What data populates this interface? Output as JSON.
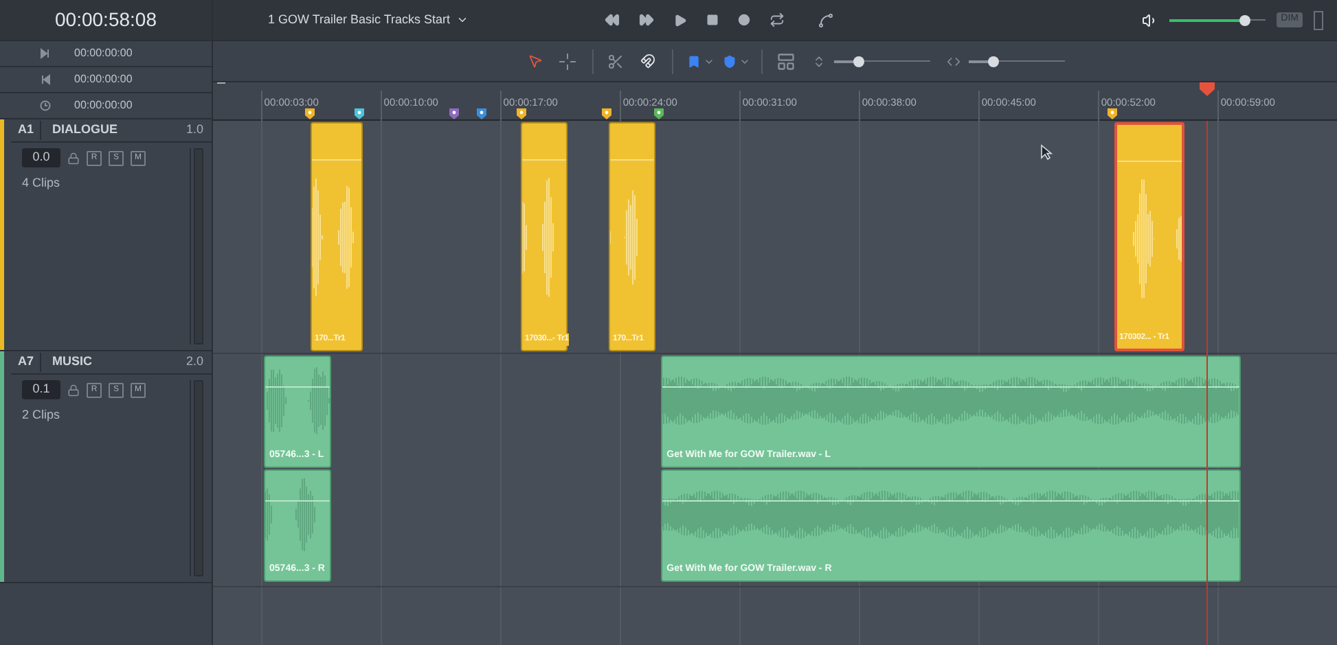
{
  "timecode": "00:00:58:08",
  "timecode_rows": [
    {
      "kind": "in",
      "value": "00:00:00:00"
    },
    {
      "kind": "out",
      "value": "00:00:00:00"
    },
    {
      "kind": "duration",
      "value": "00:00:00:00"
    }
  ],
  "timeline_name": "1 GOW Trailer Basic Tracks Start",
  "monitor": {
    "volume": {
      "level": 0.78
    },
    "dim": "DIM"
  },
  "toolbar": {
    "tools": [
      {
        "kind": "pointer",
        "selected": true
      },
      {
        "kind": "crosshair",
        "selected": false
      }
    ],
    "track_height": {
      "level": 0.25
    },
    "zoom": {
      "level": 0.25
    }
  },
  "ruler": {
    "labels": [
      "00:00:03:00",
      "00:00:10:00",
      "00:00:17:00",
      "00:00:24:00",
      "00:00:31:00",
      "00:00:38:00",
      "00:00:45:00",
      "00:00:52:00",
      "00:00:59:00"
    ]
  },
  "markers": [
    {
      "color": "#f0b429"
    },
    {
      "color": "#4fc3d9"
    },
    {
      "color": "#8e6bbf"
    },
    {
      "color": "#3b8fd9"
    },
    {
      "color": "#f0b429"
    },
    {
      "color": "#f0b429"
    },
    {
      "color": "#5cb85c"
    },
    {
      "color": "#f0b429"
    }
  ],
  "tracks": [
    {
      "id": "A1",
      "name": "DIALOGUE",
      "channels": "1.0",
      "buttons": {
        "record": "R",
        "solo": "S",
        "mute": "M"
      },
      "volume": "0.0",
      "clip_count": "4 Clips",
      "color": "#e8b923",
      "kind": "mono",
      "clips": [
        {
          "label": "170...Tr1",
          "selected": false
        },
        {
          "label": "17030...- Tr1",
          "selected": false
        },
        {
          "label": "170...Tr1",
          "selected": false
        },
        {
          "label": "170302... - Tr1",
          "selected": true
        }
      ]
    },
    {
      "id": "A7",
      "name": "MUSIC",
      "channels": "2.0",
      "buttons": {
        "record": "R",
        "solo": "S",
        "mute": "M"
      },
      "volume": "0.1",
      "clip_count": "2 Clips",
      "color": "#5fb88a",
      "kind": "stereo",
      "clips": [
        {
          "label_left": "05746...3 - L",
          "label_right": "05746...3 - R",
          "selected": false
        },
        {
          "label_left": "Get With Me for GOW Trailer.wav - L",
          "label_right": "Get With Me for GOW Trailer.wav - R",
          "selected": false
        }
      ]
    }
  ]
}
